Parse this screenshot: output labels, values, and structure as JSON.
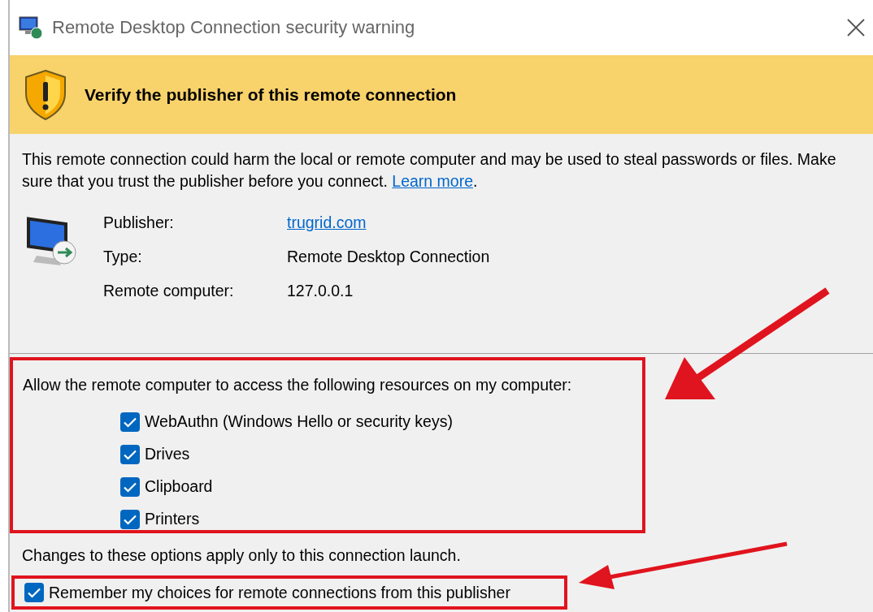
{
  "window": {
    "title": "Remote Desktop Connection security warning"
  },
  "banner": {
    "heading": "Verify the publisher of this remote connection"
  },
  "warning": {
    "text": "This remote connection could harm the local or remote computer and may be used to steal passwords or files. Make sure that you trust the publisher before you connect.",
    "link": "Learn more",
    "end": "."
  },
  "details": [
    {
      "label": "Publisher:",
      "value": "trugrid.com",
      "kind": "link"
    },
    {
      "label": "Type:",
      "value": "Remote Desktop Connection",
      "kind": "text"
    },
    {
      "label": "Remote computer:",
      "value": "127.0.0.1",
      "kind": "text"
    }
  ],
  "resources": {
    "prompt": "Allow the remote computer to access the following resources on my computer:",
    "items": [
      {
        "label": "WebAuthn (Windows Hello or security keys)",
        "checked": true
      },
      {
        "label": "Drives",
        "checked": true
      },
      {
        "label": "Clipboard",
        "checked": true
      },
      {
        "label": "Printers",
        "checked": true
      }
    ]
  },
  "note": "Changes to these options apply only to this connection launch.",
  "remember": {
    "label": "Remember my choices for remote connections from this publisher",
    "checked": true
  }
}
